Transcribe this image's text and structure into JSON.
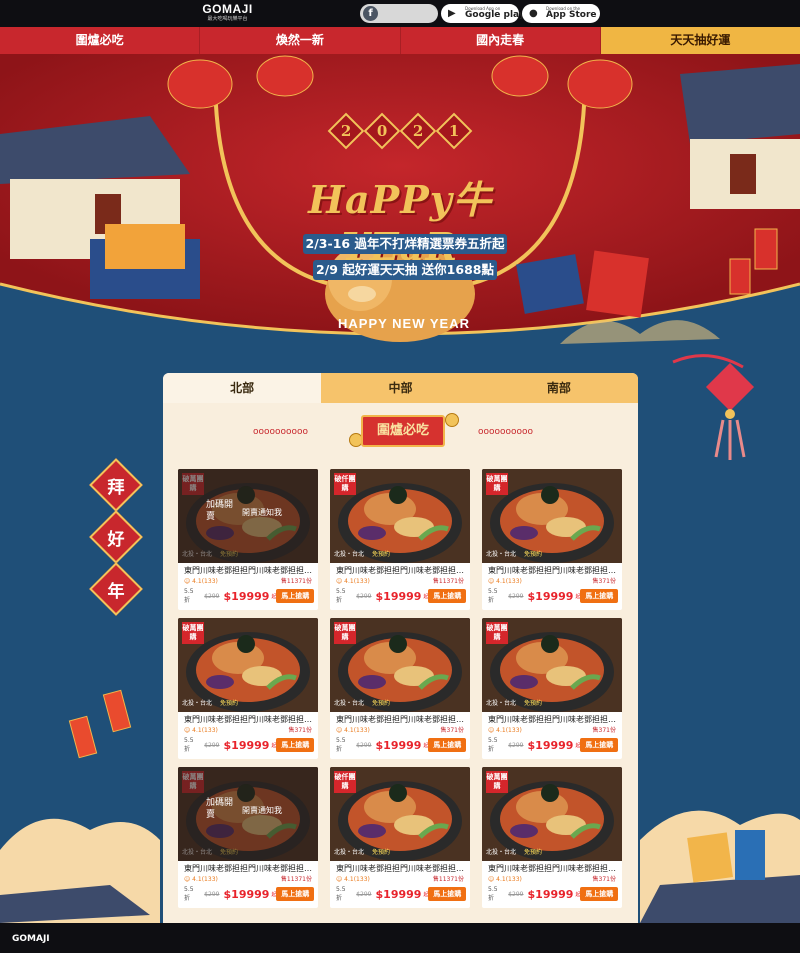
{
  "header": {
    "logo_main": "GOMAJI",
    "logo_sub": "最大吃喝玩樂平台",
    "fb_icon": "f",
    "google_small": "Download App on",
    "google_big": "Google play",
    "apple_small": "Download on the",
    "apple_big": "App Store"
  },
  "nav": {
    "tabs": [
      {
        "label": "圍爐必吃"
      },
      {
        "label": "煥然一新"
      },
      {
        "label": "國內走春"
      },
      {
        "label": "天天抽好運"
      }
    ]
  },
  "banner": {
    "year_digits": [
      "2",
      "0",
      "2",
      "1"
    ],
    "title": "HaPPy牛YEaR",
    "line1": "2/3-16 過年不打烊精選票券五折起",
    "line2": "2/9 起好運天天抽 送你1688點",
    "subtitle": "HAPPY NEW YEAR"
  },
  "side_chars": [
    "拜",
    "好",
    "年"
  ],
  "region_tabs": [
    {
      "label": "北部"
    },
    {
      "label": "中部"
    },
    {
      "label": "南部"
    }
  ],
  "section": {
    "dots_left": "oooooooooo",
    "title": "圍爐必吃",
    "dots_right": "oooooooooo"
  },
  "products": [
    {
      "badge": "破萬團購",
      "location": "北投・台北",
      "free": "免預約",
      "title": "東門川味老鄧担担門川味老鄧担担門川味老鄧担担門",
      "rating": "4.1(133)",
      "sold": "售11371份",
      "discount": "5.5 折",
      "orig": "$299",
      "price": "$19999",
      "qi": "起",
      "buy": "馬上搶購",
      "overlay": true,
      "overlay_tag": "加碼開賣",
      "overlay_msg": "開賣通知我"
    },
    {
      "badge": "破仟團購",
      "location": "北投・台北",
      "free": "免預約",
      "title": "東門川味老鄧担担門川味老鄧担担門川味老鄧担担門",
      "rating": "4.1(133)",
      "sold": "售11371份",
      "discount": "5.5 折",
      "orig": "$299",
      "price": "$19999",
      "qi": "起",
      "buy": "馬上搶購",
      "overlay": false
    },
    {
      "badge": "破萬團購",
      "location": "北投・台北",
      "free": "免預約",
      "title": "東門川味老鄧担担門川味老鄧担担門川味老鄧担担門",
      "rating": "4.1(133)",
      "sold": "售371份",
      "discount": "5.5 折",
      "orig": "$299",
      "price": "$19999",
      "qi": "起",
      "buy": "馬上搶購",
      "overlay": false
    },
    {
      "badge": "破萬團購",
      "location": "北投・台北",
      "free": "免預約",
      "title": "東門川味老鄧担担門川味老鄧担担門川味老鄧担担門",
      "rating": "4.1(133)",
      "sold": "售371份",
      "discount": "5.5 折",
      "orig": "$299",
      "price": "$19999",
      "qi": "起",
      "buy": "馬上搶購",
      "overlay": false
    },
    {
      "badge": "破萬團購",
      "location": "北投・台北",
      "free": "免預約",
      "title": "東門川味老鄧担担門川味老鄧担担門川味老鄧担担門",
      "rating": "4.1(133)",
      "sold": "售371份",
      "discount": "5.5 折",
      "orig": "$299",
      "price": "$19999",
      "qi": "起",
      "buy": "馬上搶購",
      "overlay": false
    },
    {
      "badge": "破萬團購",
      "location": "北投・台北",
      "free": "免預約",
      "title": "東門川味老鄧担担門川味老鄧担担門川味老鄧担担門",
      "rating": "4.1(133)",
      "sold": "售371份",
      "discount": "5.5 折",
      "orig": "$299",
      "price": "$19999",
      "qi": "起",
      "buy": "馬上搶購",
      "overlay": false
    },
    {
      "badge": "破萬團購",
      "location": "北投・台北",
      "free": "免預約",
      "title": "東門川味老鄧担担門川味老鄧担担門川味老鄧担担門",
      "rating": "4.1(133)",
      "sold": "售11371份",
      "discount": "5.5 折",
      "orig": "$299",
      "price": "$19999",
      "qi": "起",
      "buy": "馬上搶購",
      "overlay": true,
      "overlay_tag": "加碼開賣",
      "overlay_msg": "開賣通知我"
    },
    {
      "badge": "破仟團購",
      "location": "北投・台北",
      "free": "免預約",
      "title": "東門川味老鄧担担門川味老鄧担担門川味老鄧担担門",
      "rating": "4.1(133)",
      "sold": "售11371份",
      "discount": "5.5 折",
      "orig": "$299",
      "price": "$19999",
      "qi": "起",
      "buy": "馬上搶購",
      "overlay": false
    },
    {
      "badge": "破萬團購",
      "location": "北投・台北",
      "free": "免預約",
      "title": "東門川味老鄧担担門川味老鄧担担門川味老鄧担担門",
      "rating": "4.1(133)",
      "sold": "售371份",
      "discount": "5.5 折",
      "orig": "$299",
      "price": "$19999",
      "qi": "起",
      "buy": "馬上搶購",
      "overlay": false
    }
  ],
  "footer": {
    "logo": "GOMAJI"
  },
  "colors": {
    "brand_red": "#c8272d",
    "accent_gold": "#f0b643",
    "buy_orange": "#f06f12",
    "bg_blue": "#1f4f78"
  }
}
